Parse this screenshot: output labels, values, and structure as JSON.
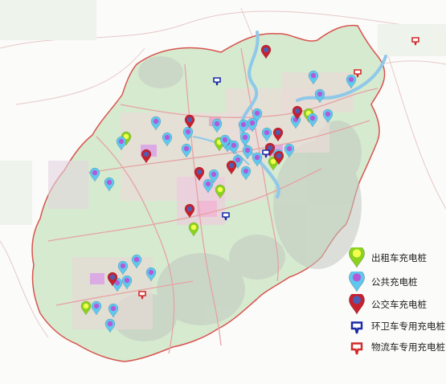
{
  "legend": {
    "items": [
      {
        "key": "taxi",
        "label": "出租车充电桩",
        "icon": "teardrop-pin-icon",
        "color": "#8bd21f",
        "center": "#f4ff4d"
      },
      {
        "key": "public",
        "label": "公共充电桩",
        "icon": "teardrop-pin-icon",
        "color": "#5ec8ee",
        "center": "#b35ad8"
      },
      {
        "key": "bus",
        "label": "公交车充电桩",
        "icon": "teardrop-pin-icon",
        "color": "#c8202c",
        "center": "#4e5db2"
      },
      {
        "key": "sanitation",
        "label": "环卫车专用充电桩",
        "icon": "flag-marker-icon",
        "color": "#1a2aa8"
      },
      {
        "key": "logistics",
        "label": "物流车专用充电桩",
        "icon": "flag-marker-icon",
        "color": "#d12a2a"
      }
    ]
  },
  "colors": {
    "background": "#ffffff",
    "region_fill": "#d6ead0",
    "boundary": "#d9534f",
    "water": "#8fc8e8",
    "road": "#e8a0a0"
  }
}
